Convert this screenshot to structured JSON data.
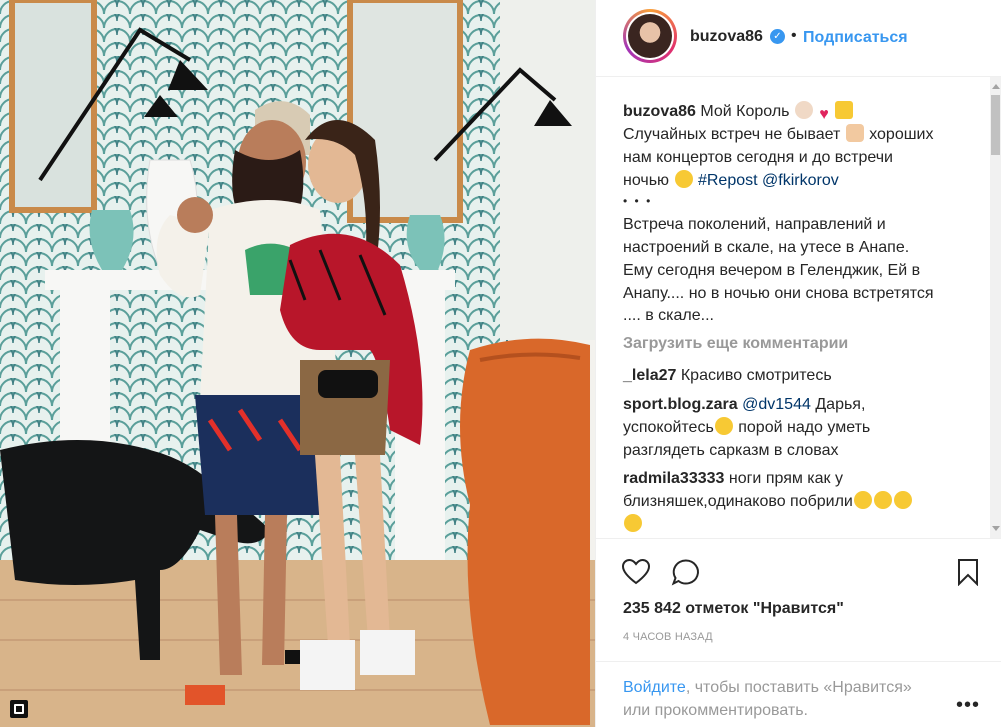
{
  "photo": {
    "alt": ""
  },
  "header": {
    "username": "buzova86",
    "separator": "•",
    "follow_label": "Подписаться",
    "verified_icon": "verified-badge-icon"
  },
  "caption": {
    "username": "buzova86",
    "line1": "Мой Король",
    "line2": "Случайных встреч не бывает",
    "line2b": "хороших",
    "line3": "нам концертов сегодня и до встречи",
    "line4": "ночью",
    "hashtag": "#Repost",
    "mention": "@fkirkorov",
    "dots": "• • •",
    "p1": "Встреча поколений, направлений и",
    "p2": "настроений в скале, на утесе в Анапе.",
    "p3": "Ему сегодня вечером в Геленджик, Ей в",
    "p4": "Анапу.... но в ночью они снова встретятся",
    "p5": ".... в скале..."
  },
  "load_more": "Загрузить еще комментарии",
  "comments": [
    {
      "user": "_lela27",
      "text": "Красиво смотритесь"
    },
    {
      "user": "sport.blog.zara",
      "mention": "@dv1544",
      "text1": "Дарья,",
      "text2": "успокойтесь",
      "text3": "порой надо уметь",
      "text4": "разглядеть сарказм в словах"
    },
    {
      "user": "radmila33333",
      "text1": "ноги прям как у",
      "text2": "близняшек,одинаково побрили"
    }
  ],
  "likes": "235 842 отметок \"Нравится\"",
  "timestamp": "4 ЧАСОВ НАЗАД",
  "login_prompt": {
    "link": "Войдите",
    "text1": ", чтобы поставить «Нравится»",
    "text2": "или прокомментировать."
  },
  "icons": {
    "like": "heart-icon",
    "comment": "comment-icon",
    "save": "bookmark-icon",
    "more": "more-options-icon"
  },
  "colors": {
    "accent": "#3897f0",
    "text": "#262626",
    "muted": "#999999",
    "link": "#003569"
  }
}
